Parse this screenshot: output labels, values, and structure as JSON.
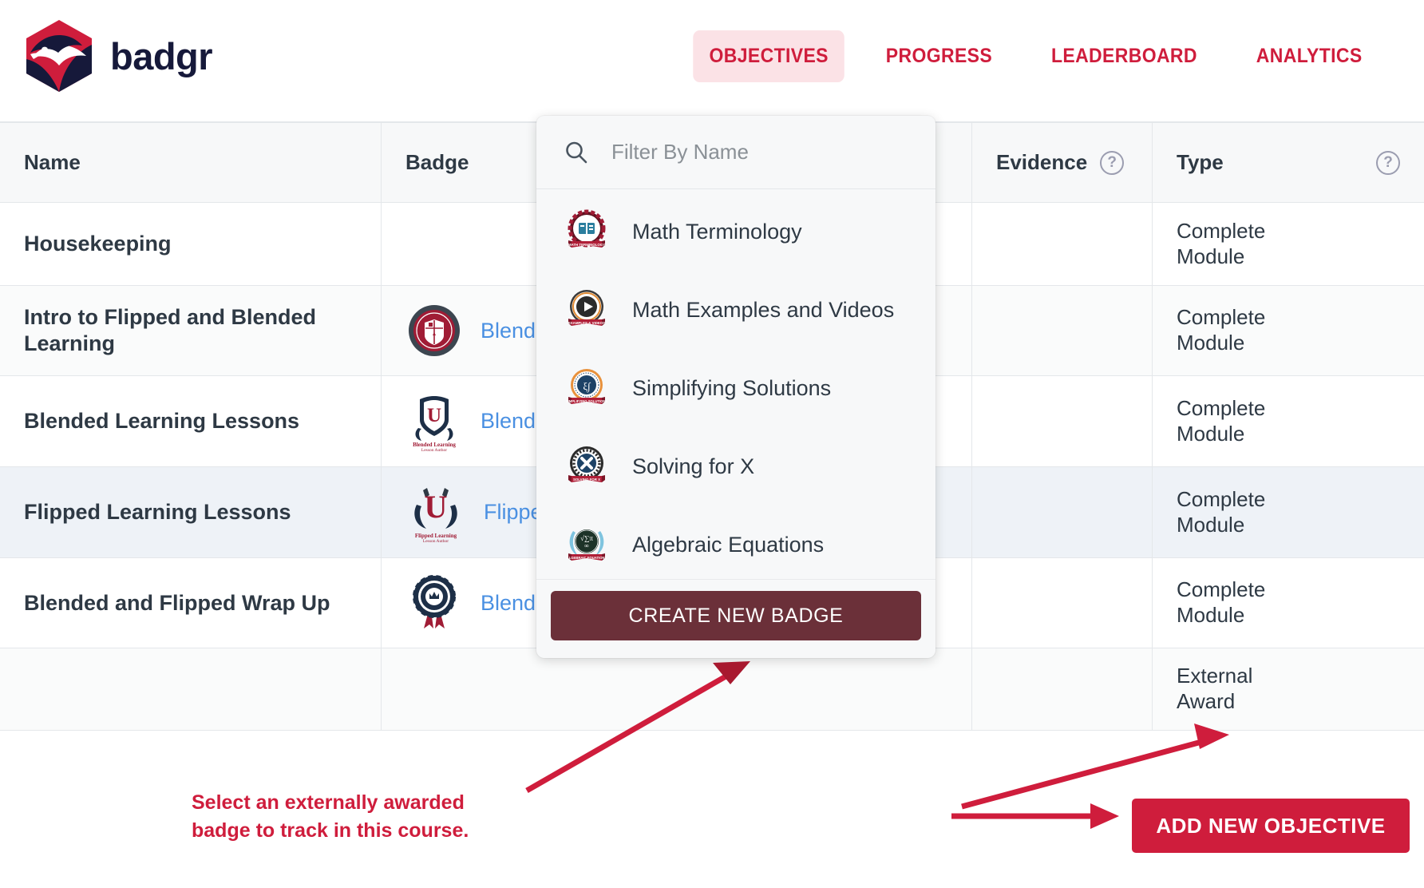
{
  "brand": {
    "name": "badgr",
    "logo_icon": "badgr-badger-hexagon-logo",
    "primary_red": "#cf1d3c",
    "logo_navy": "#16193a"
  },
  "nav": {
    "items": [
      {
        "label": "OBJECTIVES",
        "active": true
      },
      {
        "label": "PROGRESS",
        "active": false
      },
      {
        "label": "LEADERBOARD",
        "active": false
      },
      {
        "label": "ANALYTICS",
        "active": false
      }
    ],
    "active_background": "#fbe2e6"
  },
  "table": {
    "columns": [
      {
        "label": "Name",
        "help": false
      },
      {
        "label": "Badge",
        "help": false
      },
      {
        "label": "Evidence",
        "help": true,
        "help_icon": "question-mark-circle-icon"
      },
      {
        "label": "Type",
        "help": true,
        "help_icon": "question-mark-circle-icon"
      }
    ],
    "rows": [
      {
        "name": "Housekeeping",
        "badge_label": "",
        "badge_icon": "",
        "evidence": "",
        "type": "Complete Module",
        "selected": false
      },
      {
        "name": "Intro to Flipped and Blended Learning",
        "badge_label": "Blend & Flip",
        "badge_icon": "blend-and-flip-scholar-shield-badge",
        "evidence": "",
        "type": "Complete Module",
        "selected": false
      },
      {
        "name": "Blended Learning Lessons",
        "badge_label": "Blended Lea",
        "badge_icon": "blended-learning-lesson-author-u-shield-badge",
        "evidence": "",
        "type": "Complete Module",
        "selected": false
      },
      {
        "name": "Flipped Learning Lessons",
        "badge_label": "Flipped Class",
        "badge_icon": "flipped-learning-lesson-author-u-laurel-badge",
        "evidence": "",
        "type": "Complete Module",
        "selected": true
      },
      {
        "name": "Blended and Flipped Wrap Up",
        "badge_label": "Blended vs.",
        "badge_icon": "blended-vs-flipped-crown-rosette-badge",
        "evidence": "",
        "type": "Complete Module",
        "selected": false
      },
      {
        "name": "",
        "badge_label": "",
        "badge_icon": "",
        "evidence": "",
        "type": "External Award",
        "selected": false
      }
    ]
  },
  "badge_picker": {
    "search_icon": "search-icon",
    "search_placeholder": "Filter By Name",
    "search_value": "",
    "items": [
      {
        "label": "Math Terminology",
        "icon": "math-terminology-open-book-badge"
      },
      {
        "label": "Math Examples and Videos",
        "icon": "math-examples-videos-play-button-badge"
      },
      {
        "label": "Simplifying Solutions",
        "icon": "simplifying-solutions-navy-circle-badge"
      },
      {
        "label": "Solving for X",
        "icon": "solving-for-x-navy-x-badge"
      },
      {
        "label": "Algebraic Equations",
        "icon": "algebraic-equations-laurel-wreath-badge"
      }
    ],
    "create_button": "CREATE NEW BADGE",
    "create_button_color": "#6b3039"
  },
  "annotations": {
    "caption_line1": "Select an externally awarded",
    "caption_line2": "badge to track in this course.",
    "caption_color": "#cf1d3c",
    "arrow_to_badge_list": "arrow-pointing-to-badge-list",
    "arrow_to_external_award": "arrow-pointing-to-external-award-type",
    "arrow_to_add_button": "arrow-pointing-to-add-new-objective-button"
  },
  "footer": {
    "add_objective_label": "ADD NEW OBJECTIVE",
    "add_objective_color": "#cf1d3c"
  }
}
